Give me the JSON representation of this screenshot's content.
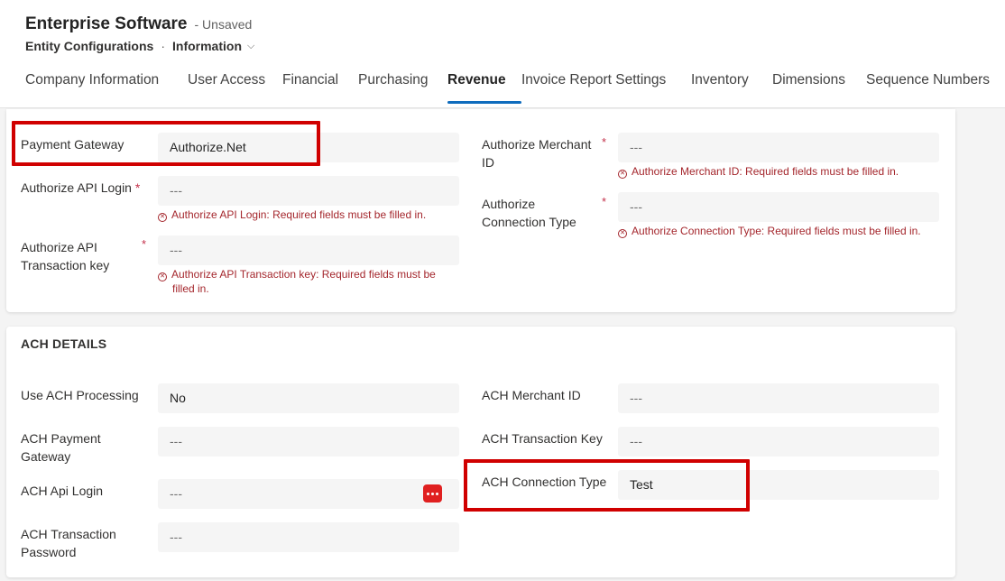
{
  "header": {
    "title": "Enterprise Software",
    "status": "- Unsaved",
    "breadcrumb": {
      "entity": "Entity Configurations",
      "separator": "·",
      "form": "Information"
    }
  },
  "tabs": [
    {
      "label": "Company Information"
    },
    {
      "label": "User Access"
    },
    {
      "label": "Financial"
    },
    {
      "label": "Purchasing"
    },
    {
      "label": "Revenue",
      "active": true
    },
    {
      "label": "Invoice Report Settings"
    },
    {
      "label": "Inventory"
    },
    {
      "label": "Dimensions"
    },
    {
      "label": "Sequence Numbers"
    }
  ],
  "authorize": {
    "payment_gateway": {
      "label": "Payment Gateway",
      "value": "Authorize.Net"
    },
    "api_login": {
      "label": "Authorize API Login",
      "required": "*",
      "value": "---",
      "error": "Authorize API Login: Required fields must be filled in."
    },
    "txn_key": {
      "label": "Authorize API Transaction key",
      "required": "*",
      "value": "---",
      "error": "Authorize API Transaction key: Required fields must be filled in."
    },
    "merchant_id": {
      "label": "Authorize Merchant ID",
      "required": "*",
      "value": "---",
      "error": "Authorize Merchant ID: Required fields must be filled in."
    },
    "connection_type": {
      "label": "Authorize Connection Type",
      "required": "*",
      "value": "---",
      "error": "Authorize Connection Type: Required fields must be filled in."
    }
  },
  "ach": {
    "section_title": "ACH DETAILS",
    "use_processing": {
      "label": "Use ACH Processing",
      "value": "No"
    },
    "payment_gateway": {
      "label": "ACH Payment Gateway",
      "value": "---"
    },
    "api_login": {
      "label": "ACH Api Login",
      "value": "---"
    },
    "txn_password": {
      "label": "ACH Transaction Password",
      "value": "---"
    },
    "merchant_id": {
      "label": "ACH Merchant ID",
      "value": "---"
    },
    "txn_key": {
      "label": "ACH Transaction Key",
      "value": "---"
    },
    "connection_type": {
      "label": "ACH Connection Type",
      "value": "Test"
    }
  },
  "icons": {
    "error": "error-circle-icon",
    "password_manager": "more-dots-icon"
  },
  "colors": {
    "accent": "#0f6cbd",
    "error": "#a4262c",
    "highlight": "#d00000",
    "dots_button": "#e02020"
  }
}
